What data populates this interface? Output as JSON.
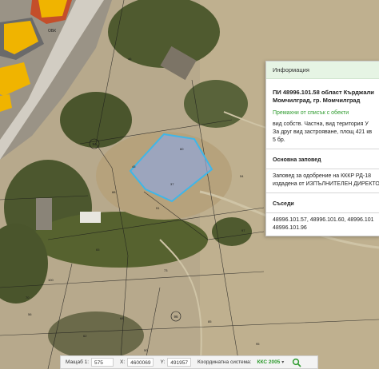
{
  "map": {
    "labels": {
      "building_label": "ОБК",
      "circle_labels": [
        "94",
        "96"
      ]
    },
    "parcel_numbers": [
      "60",
      "45",
      "37",
      "46",
      "51",
      "88",
      "65",
      "73",
      "100",
      "70",
      "68",
      "85",
      "95",
      "54",
      "98",
      "97",
      "62",
      "56",
      "50"
    ]
  },
  "panel": {
    "header": "Информация",
    "title_line1": "ПИ 48996.101.58 област Кърджали",
    "title_line2": "Момчилград, гр. Момчилград",
    "link": "Премахни от списък с обекти",
    "desc_line1": "вид собств. Частна, вид територия У",
    "desc_line2": "За друг вид застрояване, площ 421 кв",
    "desc_line3": "5 бр.",
    "section_order": "Основна заповед",
    "order_line1": "Заповед за одобрение на КККР РД-18",
    "order_line2": "издадена от ИЗПЪЛНИТЕЛЕН ДИРЕКТО",
    "section_neighbors": "Съседи",
    "neighbors_line1": "48996.101.57, 48996.101.60, 48996.101",
    "neighbors_line2": "48996.101.96"
  },
  "bottombar": {
    "scale_label": "Мащаб 1:",
    "scale_value": "575",
    "x_label": "X:",
    "x_value": "4600069",
    "y_label": "Y:",
    "y_value": "491957",
    "cs_label": "Координатна система:",
    "cs_value": "ККС 2005"
  },
  "colors": {
    "accent_green": "#2e9b2e",
    "parcel_fill": "#8fa7e0",
    "parcel_stroke": "#3fb6e8",
    "building_fill": "#f0b400"
  },
  "icons": {
    "search": "search-icon",
    "dropdown": "chevron-down-icon"
  }
}
